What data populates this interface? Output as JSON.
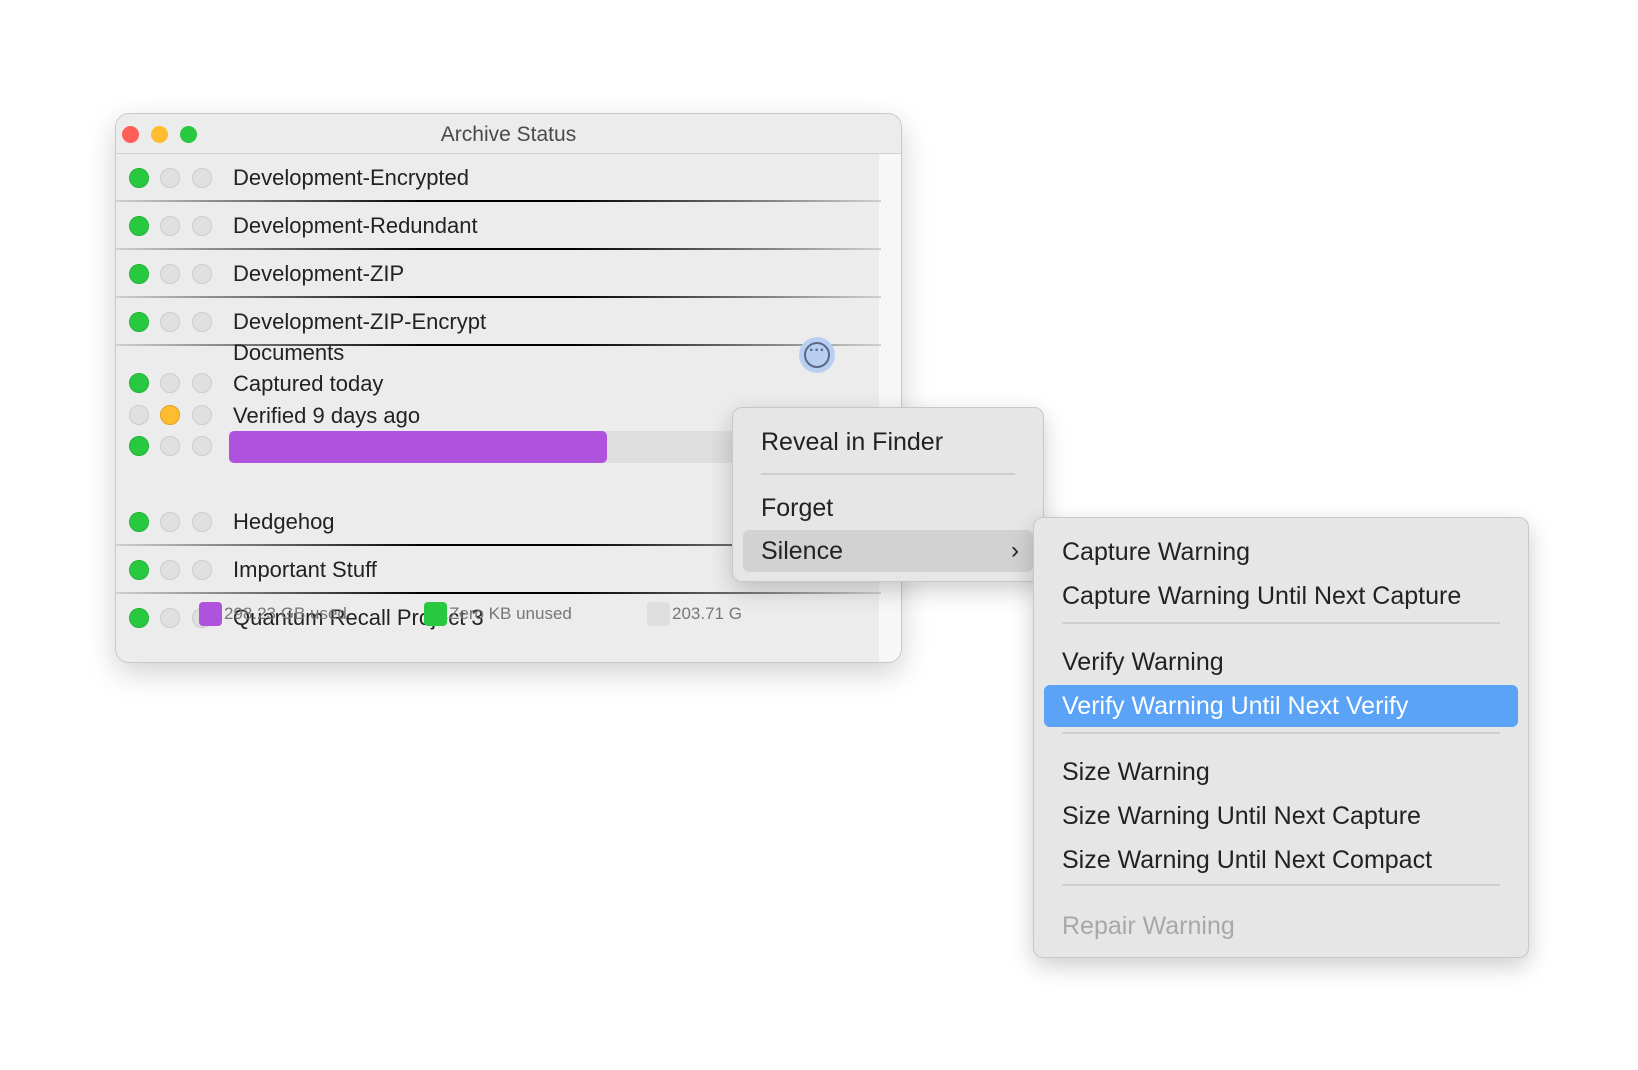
{
  "window": {
    "title": "Archive Status"
  },
  "archives": [
    {
      "name": "Development-Encrypted",
      "status": [
        "green",
        "gray",
        "gray"
      ]
    },
    {
      "name": "Development-Redundant",
      "status": [
        "green",
        "gray",
        "gray"
      ]
    },
    {
      "name": "Development-ZIP",
      "status": [
        "green",
        "gray",
        "gray"
      ]
    },
    {
      "name": "Development-ZIP-Encrypt",
      "status": [
        "green",
        "gray",
        "gray"
      ]
    },
    {
      "name": "Hedgehog",
      "status": [
        "green",
        "gray",
        "gray"
      ]
    },
    {
      "name": "Important Stuff",
      "status": [
        "green",
        "gray",
        "gray"
      ]
    },
    {
      "name": "Quantum Recall Project 3",
      "status": [
        "green",
        "gray",
        "gray"
      ]
    }
  ],
  "selected": {
    "name": "Documents",
    "capture": "Captured today",
    "verify": "Verified 9 days ago",
    "usage": {
      "used": "298.23 GB used",
      "unused": "Zero KB unused",
      "free": "203.71 G",
      "used_fraction": 0.59
    },
    "colors": {
      "used": "#af52de",
      "unused": "#28c840",
      "free": "#dedede"
    },
    "more_icon": "ellipsis-circle-icon"
  },
  "context_menu": {
    "items": [
      "Reveal in Finder",
      "Forget",
      "Silence"
    ]
  },
  "submenu": {
    "items": [
      "Capture Warning",
      "Capture Warning Until Next Capture",
      "Verify Warning",
      "Verify Warning Until Next Verify",
      "Size Warning",
      "Size Warning Until Next Capture",
      "Size Warning Until Next Compact",
      "Repair Warning"
    ],
    "highlighted": "Verify Warning Until Next Verify",
    "disabled": "Repair Warning"
  },
  "colors": {
    "highlight": "#5aa3f6",
    "green": "#28c840",
    "orange": "#febc2e"
  }
}
